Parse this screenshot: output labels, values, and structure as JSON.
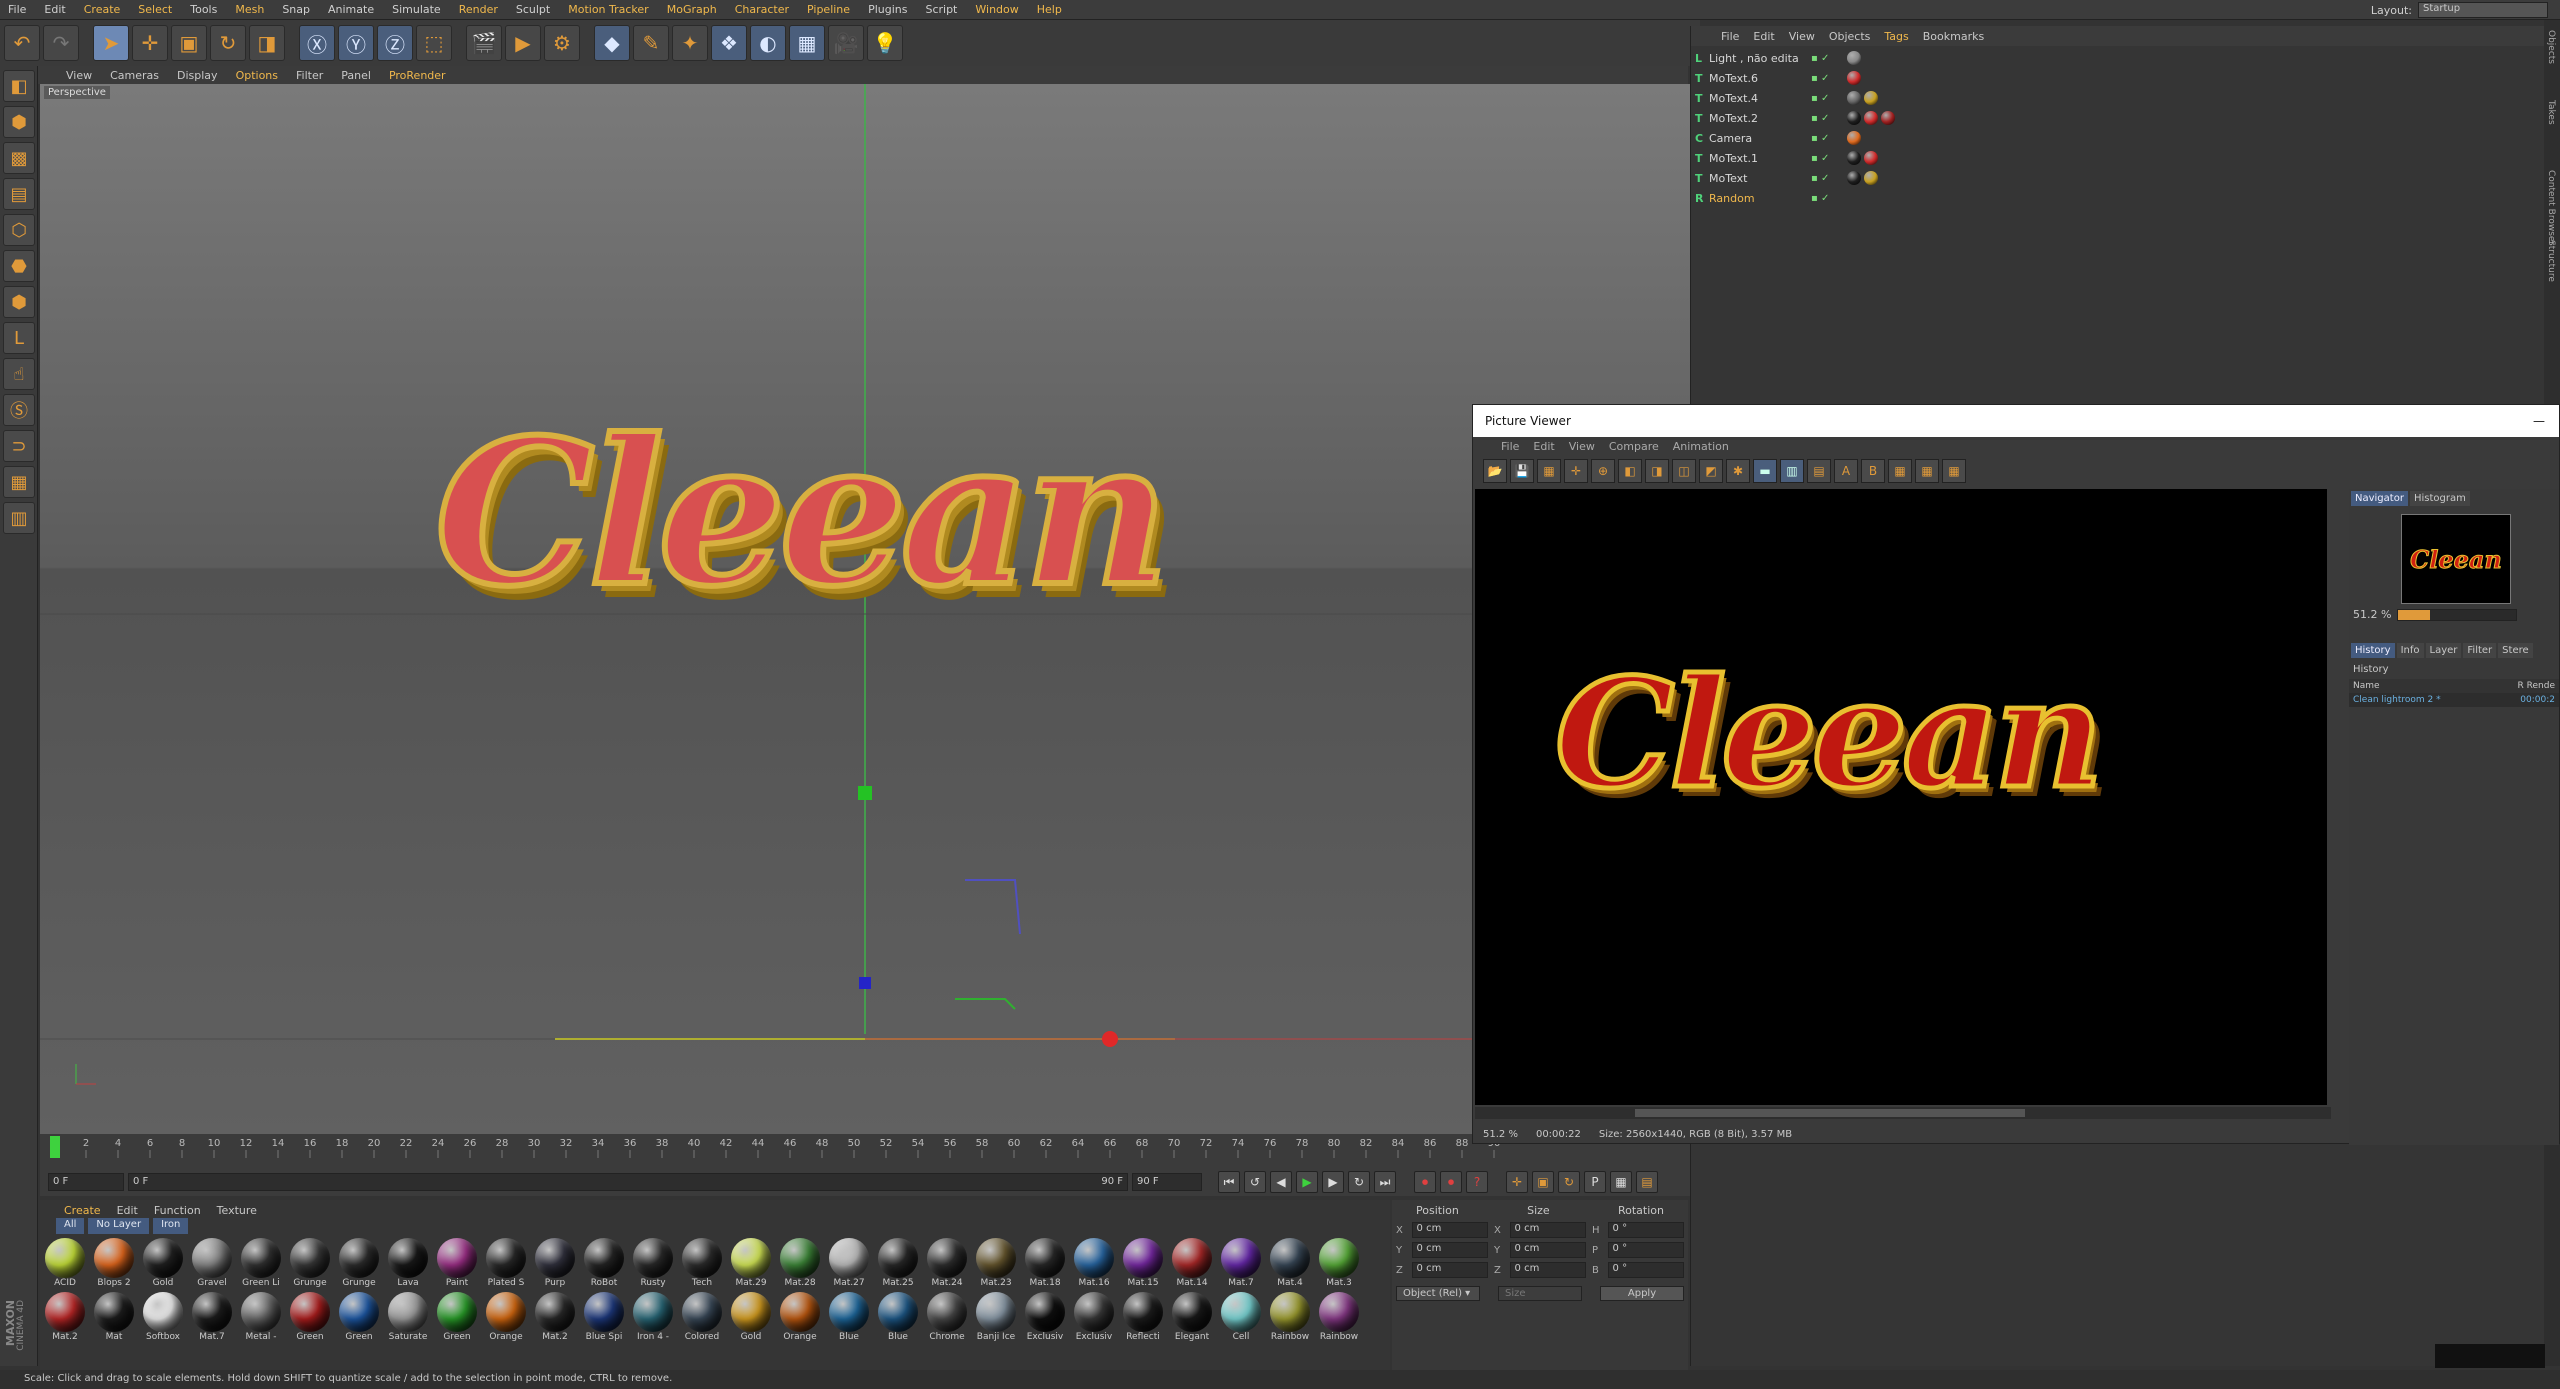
{
  "menubar": {
    "items": [
      {
        "label": "File",
        "hl": false
      },
      {
        "label": "Edit",
        "hl": false
      },
      {
        "label": "Create",
        "hl": true
      },
      {
        "label": "Select",
        "hl": true
      },
      {
        "label": "Tools",
        "hl": false
      },
      {
        "label": "Mesh",
        "hl": true
      },
      {
        "label": "Snap",
        "hl": false
      },
      {
        "label": "Animate",
        "hl": false
      },
      {
        "label": "Simulate",
        "hl": false
      },
      {
        "label": "Render",
        "hl": true
      },
      {
        "label": "Sculpt",
        "hl": false
      },
      {
        "label": "Motion Tracker",
        "hl": true
      },
      {
        "label": "MoGraph",
        "hl": true
      },
      {
        "label": "Character",
        "hl": true
      },
      {
        "label": "Pipeline",
        "hl": true
      },
      {
        "label": "Plugins",
        "hl": false
      },
      {
        "label": "Script",
        "hl": false
      },
      {
        "label": "Window",
        "hl": true
      },
      {
        "label": "Help",
        "hl": true
      }
    ],
    "layout_label": "Layout:",
    "layout_value": "Startup"
  },
  "viewport": {
    "menu": [
      {
        "label": "View",
        "hl": false
      },
      {
        "label": "Cameras",
        "hl": false
      },
      {
        "label": "Display",
        "hl": false
      },
      {
        "label": "Options",
        "hl": true
      },
      {
        "label": "Filter",
        "hl": false
      },
      {
        "label": "Panel",
        "hl": false
      },
      {
        "label": "ProRender",
        "hl": true
      }
    ],
    "camera_label": "Perspective",
    "text": "Cleean"
  },
  "timeline": {
    "ticks": [
      "0",
      "2",
      "4",
      "6",
      "8",
      "10",
      "12",
      "14",
      "16",
      "18",
      "20",
      "22",
      "24",
      "26",
      "28",
      "30",
      "32",
      "34",
      "36",
      "38",
      "40",
      "42",
      "44",
      "46",
      "48",
      "50",
      "52",
      "54",
      "56",
      "58",
      "60",
      "62",
      "64",
      "66",
      "68",
      "70",
      "72",
      "74",
      "76",
      "78",
      "80",
      "82",
      "84",
      "86",
      "88",
      "90"
    ],
    "start_frame": "0 F",
    "slider_start": "0 F",
    "slider_end": "90 F",
    "end_frame": "90 F",
    "current_frame": "0 F"
  },
  "materials": {
    "menu": [
      "Create",
      "Edit",
      "Function",
      "Texture"
    ],
    "filters": [
      "All",
      "No Layer",
      "Iron"
    ],
    "row1": [
      {
        "name": "ACID",
        "color": "#c9e43a"
      },
      {
        "name": "Blops 2",
        "color": "#e86a1e"
      },
      {
        "name": "Gold",
        "color": "#222222"
      },
      {
        "name": "Gravel",
        "color": "#8a8a8a"
      },
      {
        "name": "Green Li",
        "color": "#333333"
      },
      {
        "name": "Grunge",
        "color": "#3a3a3a"
      },
      {
        "name": "Grunge",
        "color": "#2e2e2e"
      },
      {
        "name": "Lava",
        "color": "#1a1a1a"
      },
      {
        "name": "Paint",
        "color": "#a0308a"
      },
      {
        "name": "Plated S",
        "color": "#2a2a2a"
      },
      {
        "name": "Purp",
        "color": "#333340"
      },
      {
        "name": "RoBot",
        "color": "#262626"
      },
      {
        "name": "Rusty",
        "color": "#2b2b2b"
      },
      {
        "name": "Tech",
        "color": "#2e2e2e"
      },
      {
        "name": "Mat.29",
        "color": "#d8ec58"
      },
      {
        "name": "Mat.28",
        "color": "#3f8a3a"
      },
      {
        "name": "Mat.27",
        "color": "#c0c0c0"
      },
      {
        "name": "Mat.25",
        "color": "#2a2a2a"
      },
      {
        "name": "Mat.24",
        "color": "#303030"
      },
      {
        "name": "Mat.23",
        "color": "#6a5a30"
      },
      {
        "name": "Mat.18",
        "color": "#2a2a2a"
      },
      {
        "name": "Mat.16",
        "color": "#2a6aa8"
      },
      {
        "name": "Mat.15",
        "color": "#7a2aa8"
      },
      {
        "name": "Mat.14",
        "color": "#b02a2a"
      },
      {
        "name": "Mat.7",
        "color": "#6a2ab0"
      },
      {
        "name": "Mat.4",
        "color": "#3a4a5a"
      },
      {
        "name": "Mat.3",
        "color": "#5ab03a"
      }
    ],
    "row2": [
      {
        "name": "Mat.2",
        "color": "#c02828"
      },
      {
        "name": "Mat",
        "color": "#1e1e1e"
      },
      {
        "name": "Softbox",
        "color": "#f4f4f4"
      },
      {
        "name": "Mat.7",
        "color": "#1e1e1e"
      },
      {
        "name": "Metal -",
        "color": "#6a6a6a"
      },
      {
        "name": "Green",
        "color": "#b01e1e"
      },
      {
        "name": "Green",
        "color": "#1e5aa8"
      },
      {
        "name": "Saturate",
        "color": "#a0a0a0"
      },
      {
        "name": "Green",
        "color": "#2aa02a"
      },
      {
        "name": "Orange",
        "color": "#d86a10"
      },
      {
        "name": "Mat.2",
        "color": "#2a2a2a"
      },
      {
        "name": "Blue Spi",
        "color": "#1e3a80"
      },
      {
        "name": "Iron 4 -",
        "color": "#2a6a7a"
      },
      {
        "name": "Colored",
        "color": "#3a4a5a"
      },
      {
        "name": "Gold",
        "color": "#d8a020"
      },
      {
        "name": "Orange",
        "color": "#c05a10"
      },
      {
        "name": "Blue",
        "color": "#1e6aa0"
      },
      {
        "name": "Blue",
        "color": "#1e5a8a"
      },
      {
        "name": "Chrome",
        "color": "#4a4a4a"
      },
      {
        "name": "Banji Ice",
        "color": "#8a9aa8"
      },
      {
        "name": "Exclusiv",
        "color": "#101010"
      },
      {
        "name": "Exclusiv",
        "color": "#3a3a3a"
      },
      {
        "name": "Reflecti",
        "color": "#1e1e1e"
      },
      {
        "name": "Elegant",
        "color": "#1a1a1a"
      },
      {
        "name": "Cell",
        "color": "#7ad8d8"
      },
      {
        "name": "Rainbow",
        "color": "#a0a030"
      },
      {
        "name": "Rainbow",
        "color": "#8a3a8a"
      }
    ]
  },
  "coords": {
    "headers": [
      "Position",
      "Size",
      "Rotation"
    ],
    "rows": [
      {
        "axis": "X",
        "pos": "0 cm",
        "saxis": "X",
        "size": "0 cm",
        "raxis": "H",
        "rot": "0 °"
      },
      {
        "axis": "Y",
        "pos": "0 cm",
        "saxis": "Y",
        "size": "0 cm",
        "raxis": "P",
        "rot": "0 °"
      },
      {
        "axis": "Z",
        "pos": "0 cm",
        "saxis": "Z",
        "size": "0 cm",
        "raxis": "B",
        "rot": "0 °"
      }
    ],
    "mode": "Object (Rel) ▾",
    "size_mode": "Size",
    "apply": "Apply"
  },
  "objects": {
    "menu": [
      {
        "label": "File",
        "hl": false
      },
      {
        "label": "Edit",
        "hl": false
      },
      {
        "label": "View",
        "hl": false
      },
      {
        "label": "Objects",
        "hl": false
      },
      {
        "label": "Tags",
        "hl": true
      },
      {
        "label": "Bookmarks",
        "hl": false
      }
    ],
    "items": [
      {
        "name": "Light , não edita",
        "icon": "L",
        "tags": [
          "#888888"
        ],
        "color": "#d8d8d8"
      },
      {
        "name": "MoText.6",
        "icon": "T",
        "tags": [
          "#d02a2a"
        ],
        "color": "#d8d8d8"
      },
      {
        "name": "MoText.4",
        "icon": "T",
        "tags": [
          "#666666",
          "#c8a020"
        ],
        "color": "#d8d8d8"
      },
      {
        "name": "MoText.2",
        "icon": "T",
        "tags": [
          "#1e1e1e",
          "#d02a2a",
          "#a02020"
        ],
        "color": "#d8d8d8"
      },
      {
        "name": "Camera",
        "icon": "C",
        "tags": [
          "#e06a1e"
        ],
        "color": "#d8d8d8"
      },
      {
        "name": "MoText.1",
        "icon": "T",
        "tags": [
          "#1e1e1e",
          "#d02a2a"
        ],
        "color": "#d8d8d8"
      },
      {
        "name": "MoText",
        "icon": "T",
        "tags": [
          "#1e1e1e",
          "#c8a020"
        ],
        "color": "#d8d8d8"
      },
      {
        "name": "Random",
        "icon": "R",
        "tags": [],
        "color": "#f0b84c"
      }
    ]
  },
  "sidestrip": [
    "Objects",
    "Takes",
    "Content Browser",
    "Structure"
  ],
  "picture_viewer": {
    "title": "Picture Viewer",
    "close": "—",
    "menu": [
      "File",
      "Edit",
      "View",
      "Compare",
      "Animation"
    ],
    "image_text": "Cleean",
    "status_zoom": "51.2 %",
    "status_time": "00:00:22",
    "status_size": "Size: 2560x1440, RGB (8 Bit), 3.57 MB",
    "nav_tabs": [
      "Navigator",
      "Histogram"
    ],
    "nav_zoom": "51.2 %",
    "hist_tabs": [
      "History",
      "Info",
      "Layer",
      "Filter",
      "Stere"
    ],
    "hist_title": "History",
    "col_name": "Name",
    "col_r": "R",
    "col_render": "Rende",
    "entry_name": "Clean lightroom 2 *",
    "entry_time": "00:00:2"
  },
  "statusbar": "Scale: Click and drag to scale elements. Hold down SHIFT to quantize scale / add to the selection in point mode, CTRL to remove.",
  "logo": {
    "line1": "MAXON",
    "line2": "CINEMA 4D"
  }
}
